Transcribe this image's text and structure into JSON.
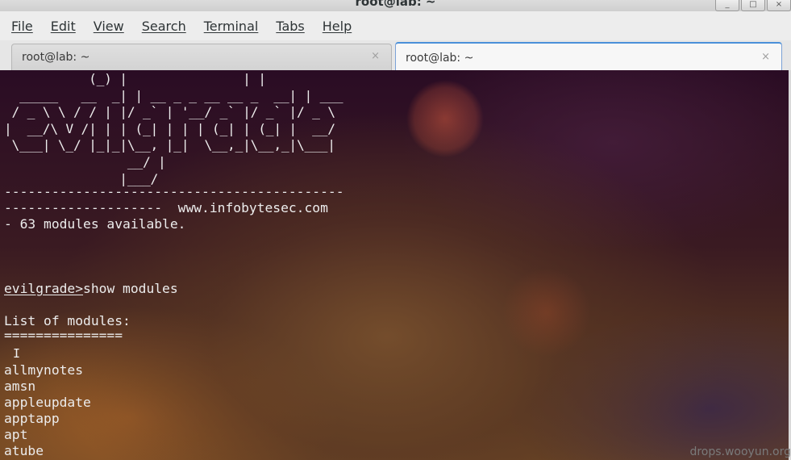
{
  "window": {
    "title": "root@lab: ~",
    "controls": [
      "minimize-icon",
      "maximize-icon",
      "close-icon"
    ]
  },
  "menu": [
    "File",
    "Edit",
    "View",
    "Search",
    "Terminal",
    "Tabs",
    "Help"
  ],
  "tabs": [
    {
      "label": "root@lab: ~",
      "close": "×",
      "active": false
    },
    {
      "label": "root@lab: ~",
      "close": "×",
      "active": true
    }
  ],
  "terminal": {
    "banner": "           (_) |               | |\n  _____   __  _| | __ _ _ __ __ _  __| | ___\n / _ \\ \\ / / | |/ _` | '__/ _` |/ _` |/ _ \\\n|  __/\\ V /| | | (_| | | | (_| | (_| |  __/\n \\___| \\_/ |_|_|\\__, |_|  \\__,_|\\__,_|\\___|\n                __/ |\n               |___/",
    "separator": "-------------------------------------------",
    "site_line": "--------------------  www.infobytesec.com",
    "modules_available": "- 63 modules available.",
    "prompt": "evilgrade>",
    "command": "show modules",
    "list_header": "List of modules:",
    "list_underline": "===============",
    "modules": [
      "allmynotes",
      "amsn",
      "appleupdate",
      "apptapp",
      "apt",
      "atube"
    ]
  },
  "watermark": "drops.wooyun.org",
  "colors": {
    "terminal_text": "#ececec",
    "active_tab_accent": "#4a90d9"
  }
}
